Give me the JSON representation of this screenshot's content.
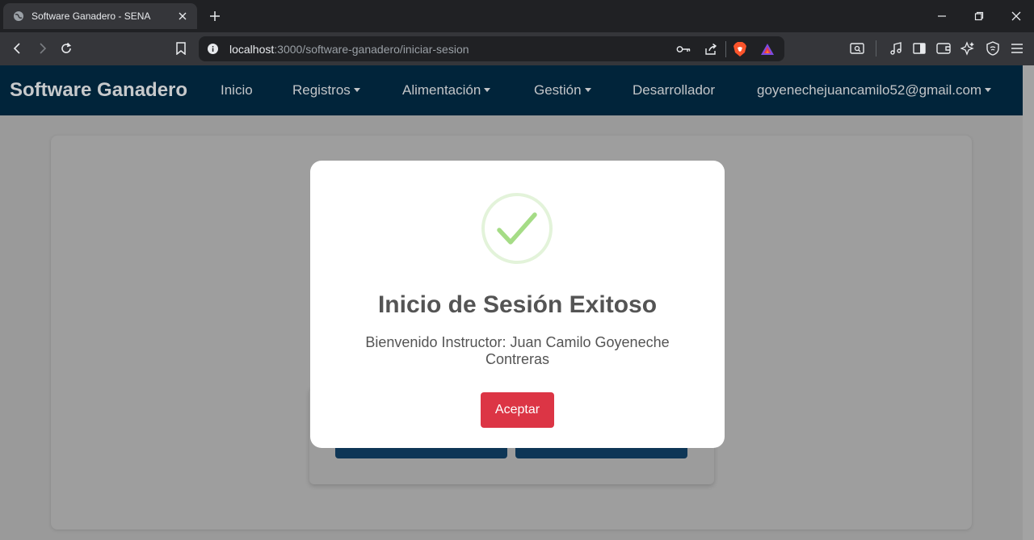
{
  "browser": {
    "tab_title": "Software Ganadero - SENA",
    "url_host": "localhost",
    "url_path": ":3000/software-ganadero/iniciar-sesion"
  },
  "navbar": {
    "brand": "Software Ganadero",
    "links": [
      {
        "label": "Inicio"
      },
      {
        "label": "Registros"
      },
      {
        "label": "Alimentación"
      },
      {
        "label": "Gestión"
      },
      {
        "label": "Desarrollador"
      },
      {
        "label": "goyenechejuancamilo52@gmail.com"
      }
    ]
  },
  "modal": {
    "title": "Inicio de Sesión Exitoso",
    "message": "Bienvenido Instructor: Juan Camilo Goyeneche Contreras",
    "accept_label": "Aceptar",
    "icon": "success-check-icon"
  },
  "colors": {
    "navbar_bg": "#01243a",
    "accept_button": "#dc3545",
    "success_check": "#a5dc86"
  }
}
